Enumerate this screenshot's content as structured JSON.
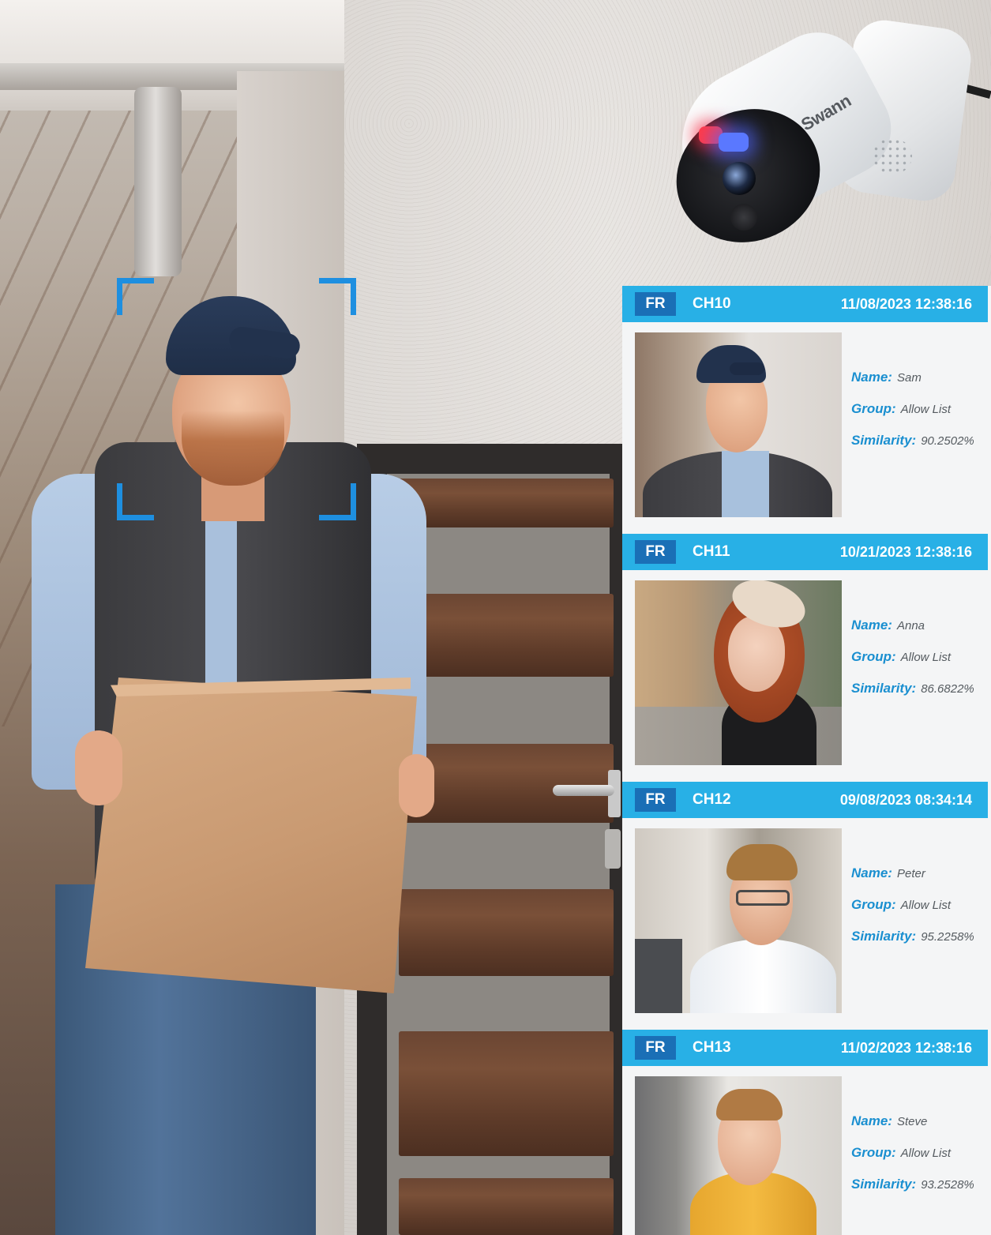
{
  "camera": {
    "brand": "Swann"
  },
  "detections": [
    {
      "tag": "FR",
      "channel": "CH10",
      "timestamp": "11/08/2023  12:38:16",
      "name_label": "Name:",
      "name": "Sam",
      "group_label": "Group:",
      "group": "Allow List",
      "similarity_label": "Similarity:",
      "similarity": "90.2502%"
    },
    {
      "tag": "FR",
      "channel": "CH11",
      "timestamp": "10/21/2023  12:38:16",
      "name_label": "Name:",
      "name": "Anna",
      "group_label": "Group:",
      "group": "Allow List",
      "similarity_label": "Similarity:",
      "similarity": "86.6822%"
    },
    {
      "tag": "FR",
      "channel": "CH12",
      "timestamp": "09/08/2023  08:34:14",
      "name_label": "Name:",
      "name": "Peter",
      "group_label": "Group:",
      "group": "Allow List",
      "similarity_label": "Similarity:",
      "similarity": "95.2258%"
    },
    {
      "tag": "FR",
      "channel": "CH13",
      "timestamp": "11/02/2023  12:38:16",
      "name_label": "Name:",
      "name": "Steve",
      "group_label": "Group:",
      "group": "Allow List",
      "similarity_label": "Similarity:",
      "similarity": "93.2528%"
    }
  ],
  "colors": {
    "header_blue": "#28b0e6",
    "tag_blue": "#1a6fb6",
    "label_blue": "#1a8fd0",
    "bracket_blue": "#1e8fe0"
  }
}
